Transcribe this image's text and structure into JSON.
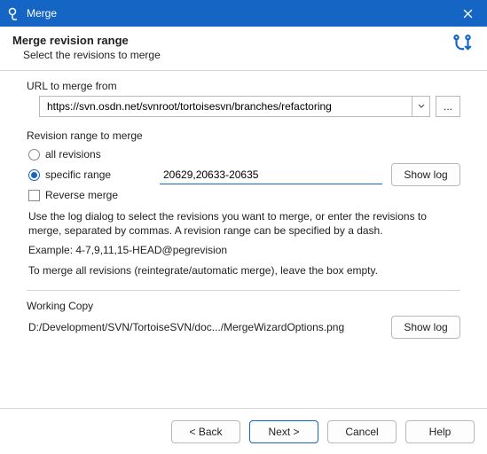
{
  "window": {
    "title": "Merge"
  },
  "header": {
    "title": "Merge revision range",
    "subtitle": "Select the revisions to merge"
  },
  "url_group": {
    "label": "URL to merge from",
    "value": "https://svn.osdn.net/svnroot/tortoisesvn/branches/refactoring",
    "browse_label": "..."
  },
  "rev_group": {
    "label": "Revision range to merge",
    "all_label": "all revisions",
    "specific_label": "specific range",
    "range_value": "20629,20633-20635",
    "show_log_label": "Show log",
    "reverse_label": "Reverse merge",
    "help1": "Use the log dialog to select the revisions you want to merge, or enter the revisions to merge, separated by commas. A revision range can be specified by a dash.",
    "help2": "Example: 4-7,9,11,15-HEAD@pegrevision",
    "help3": "To merge all revisions (reintegrate/automatic merge), leave the box empty."
  },
  "wc_group": {
    "label": "Working Copy",
    "path": "D:/Development/SVN/TortoiseSVN/doc.../MergeWizardOptions.png",
    "show_log_label": "Show log"
  },
  "footer": {
    "back": "< Back",
    "next": "Next >",
    "cancel": "Cancel",
    "help": "Help"
  }
}
